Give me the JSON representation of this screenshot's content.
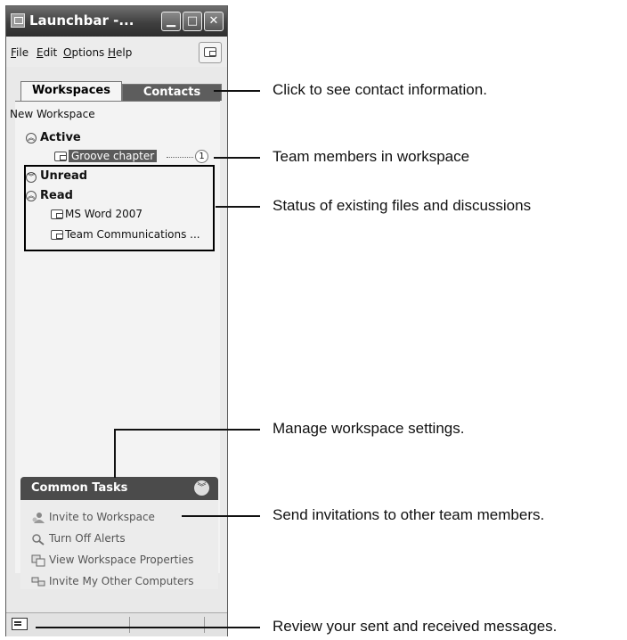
{
  "window": {
    "title": "Launchbar -...",
    "controls": {
      "minimize": "▁",
      "maximize": "□",
      "close": "✕"
    }
  },
  "menu": {
    "file": {
      "key": "F",
      "rest": "ile"
    },
    "edit": {
      "key": "E",
      "rest": "dit"
    },
    "options": {
      "key": "O",
      "rest": "ptions"
    },
    "help": {
      "key": "H",
      "rest": "elp"
    }
  },
  "tabs": {
    "workspaces": "Workspaces",
    "contacts": "Contacts"
  },
  "list": {
    "new_workspace": "New Workspace",
    "active": {
      "label": "Active",
      "items": [
        {
          "label": "Groove chapter",
          "members": "1"
        }
      ]
    },
    "unread": {
      "label": "Unread"
    },
    "read": {
      "label": "Read",
      "items": [
        {
          "label": "MS Word 2007"
        },
        {
          "label": "Team Communications ..."
        }
      ]
    }
  },
  "tasks": {
    "title": "Common Tasks",
    "items": [
      {
        "label": "Invite to Workspace",
        "icon": "invite-icon"
      },
      {
        "label": "Turn Off Alerts",
        "icon": "alerts-icon"
      },
      {
        "label": "View Workspace Properties",
        "icon": "properties-icon"
      },
      {
        "label": "Invite My Other Computers",
        "icon": "computers-icon"
      }
    ]
  },
  "callouts": [
    "Click to see contact information.",
    "Team members in workspace",
    "Status of existing files and discussions",
    "Manage workspace settings.",
    "Send invitations to other team members.",
    "Review your sent and received messages."
  ]
}
